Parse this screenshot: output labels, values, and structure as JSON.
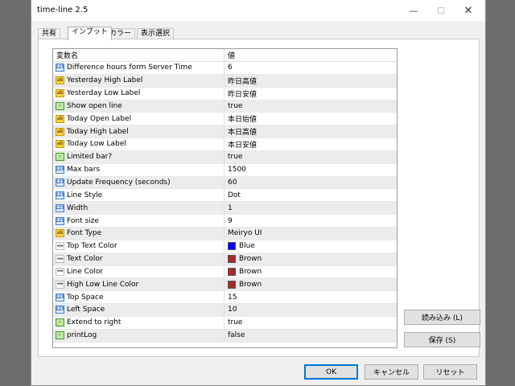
{
  "window": {
    "title": "time-line 2.5"
  },
  "titlebar": {
    "minimize": "—",
    "maximize": "☐",
    "close": "✕"
  },
  "tabs": [
    {
      "label": "共有"
    },
    {
      "label": "インプット",
      "active": true
    },
    {
      "label": "カラー"
    },
    {
      "label": "表示選択"
    }
  ],
  "grid": {
    "header": {
      "name": "変数名",
      "value": "値"
    },
    "rows": [
      {
        "type": "num",
        "icon": "123",
        "name": "Difference hours form Server Time",
        "value": "6"
      },
      {
        "type": "str",
        "icon": "ab",
        "name": "Yesterday High Label",
        "value": "昨日高値"
      },
      {
        "type": "str",
        "icon": "ab",
        "name": "Yesterday Low Label",
        "value": "昨日安値"
      },
      {
        "type": "bool",
        "icon": "✓",
        "name": "Show open line",
        "value": "true"
      },
      {
        "type": "str",
        "icon": "ab",
        "name": "Today Open Label",
        "value": "本日始値"
      },
      {
        "type": "str",
        "icon": "ab",
        "name": "Today High Label",
        "value": "本日高値"
      },
      {
        "type": "str",
        "icon": "ab",
        "name": "Today Low Label",
        "value": "本日安値"
      },
      {
        "type": "bool",
        "icon": "✓",
        "name": "Limited bar?",
        "value": "true"
      },
      {
        "type": "num",
        "icon": "123",
        "name": "Max bars",
        "value": "1500"
      },
      {
        "type": "num",
        "icon": "123",
        "name": "Update Frequency (seconds)",
        "value": "60"
      },
      {
        "type": "num",
        "icon": "123",
        "name": "Line Style",
        "value": "Dot"
      },
      {
        "type": "num",
        "icon": "123",
        "name": "Width",
        "value": "1"
      },
      {
        "type": "num",
        "icon": "123",
        "name": "Font size",
        "value": "9"
      },
      {
        "type": "str",
        "icon": "ab",
        "name": "Font Type",
        "value": "Meiryo UI"
      },
      {
        "type": "color",
        "icon": "▪▪▪",
        "name": "Top Text Color",
        "value": "Blue",
        "swatch": "#0000ff"
      },
      {
        "type": "color",
        "icon": "▪▪▪",
        "name": "Text Color",
        "value": "Brown",
        "swatch": "#a52a2a"
      },
      {
        "type": "color",
        "icon": "▪▪▪",
        "name": "Line Color",
        "value": "Brown",
        "swatch": "#a52a2a"
      },
      {
        "type": "color",
        "icon": "▪▪▪",
        "name": "High Low Line Color",
        "value": "Brown",
        "swatch": "#a52a2a"
      },
      {
        "type": "num",
        "icon": "123",
        "name": "Top Space",
        "value": "15"
      },
      {
        "type": "num",
        "icon": "123",
        "name": "Left Space",
        "value": "10"
      },
      {
        "type": "bool",
        "icon": "✓",
        "name": "Extend to right",
        "value": "true"
      },
      {
        "type": "bool",
        "icon": "✓",
        "name": "printLog",
        "value": "false"
      }
    ]
  },
  "side_buttons": {
    "load": "読み込み (L)",
    "save": "保存 (S)"
  },
  "footer": {
    "ok": "OK",
    "cancel": "キャンセル",
    "reset": "リセット"
  }
}
